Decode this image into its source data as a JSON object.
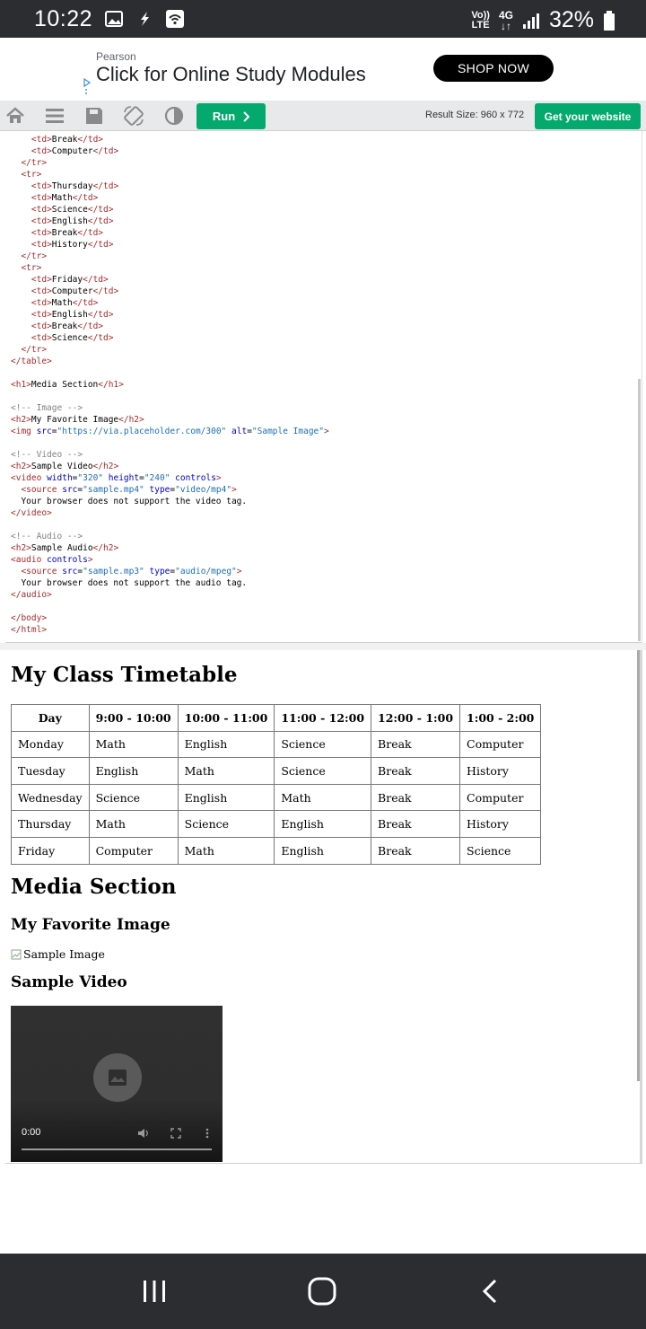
{
  "status_bar": {
    "time": "10:22",
    "volte_top": "Vo))",
    "volte_bottom": "LTE",
    "network": "4G",
    "battery": "32%"
  },
  "ad": {
    "brand": "Pearson",
    "headline": "Click for Online Study Modules",
    "cta": "SHOP NOW"
  },
  "toolbar": {
    "run_label": "Run",
    "result_size": "Result Size: 960 x 772",
    "website_label": "Get your website"
  },
  "code_lines": [
    "    <td>Break</td>",
    "    <td>Computer</td>",
    "  </tr>",
    "  <tr>",
    "    <td>Thursday</td>",
    "    <td>Math</td>",
    "    <td>Science</td>",
    "    <td>English</td>",
    "    <td>Break</td>",
    "    <td>History</td>",
    "  </tr>",
    "  <tr>",
    "    <td>Friday</td>",
    "    <td>Computer</td>",
    "    <td>Math</td>",
    "    <td>English</td>",
    "    <td>Break</td>",
    "    <td>Science</td>",
    "  </tr>",
    "</table>",
    "",
    "<h1>Media Section</h1>",
    "",
    "<!-- Image -->",
    "<h2>My Favorite Image</h2>",
    "<img src=\"https://via.placeholder.com/300\" alt=\"Sample Image\">",
    "",
    "<!-- Video -->",
    "<h2>Sample Video</h2>",
    "<video width=\"320\" height=\"240\" controls>",
    "  <source src=\"sample.mp4\" type=\"video/mp4\">",
    "  Your browser does not support the video tag.",
    "</video>",
    "",
    "<!-- Audio -->",
    "<h2>Sample Audio</h2>",
    "<audio controls>",
    "  <source src=\"sample.mp3\" type=\"audio/mpeg\">",
    "  Your browser does not support the audio tag.",
    "</audio>",
    "",
    "</body>",
    "</html>"
  ],
  "result": {
    "title": "My Class Timetable",
    "table": {
      "headers": [
        "Day",
        "9:00 - 10:00",
        "10:00 - 11:00",
        "11:00 - 12:00",
        "12:00 - 1:00",
        "1:00 - 2:00"
      ],
      "rows": [
        [
          "Monday",
          "Math",
          "English",
          "Science",
          "Break",
          "Computer"
        ],
        [
          "Tuesday",
          "English",
          "Math",
          "Science",
          "Break",
          "History"
        ],
        [
          "Wednesday",
          "Science",
          "English",
          "Math",
          "Break",
          "Computer"
        ],
        [
          "Thursday",
          "Math",
          "Science",
          "English",
          "Break",
          "History"
        ],
        [
          "Friday",
          "Computer",
          "Math",
          "English",
          "Break",
          "Science"
        ]
      ]
    },
    "media_heading": "Media Section",
    "image_heading": "My Favorite Image",
    "image_alt": "Sample Image",
    "video_heading": "Sample Video",
    "video_time": "0:00",
    "video_progress": 0
  },
  "colors": {
    "accent_green": "#04aa6d",
    "status_bar_bg": "#2b2d30",
    "tag_color": "#a52a2a",
    "attr_value_color": "#1e6db3",
    "comment_color": "#808080"
  },
  "icons": {
    "toolbar": [
      "home-icon",
      "menu-icon",
      "save-icon",
      "rotate-icon",
      "contrast-icon"
    ],
    "nav": [
      "recent-apps-icon",
      "home-button-icon",
      "back-icon"
    ]
  }
}
